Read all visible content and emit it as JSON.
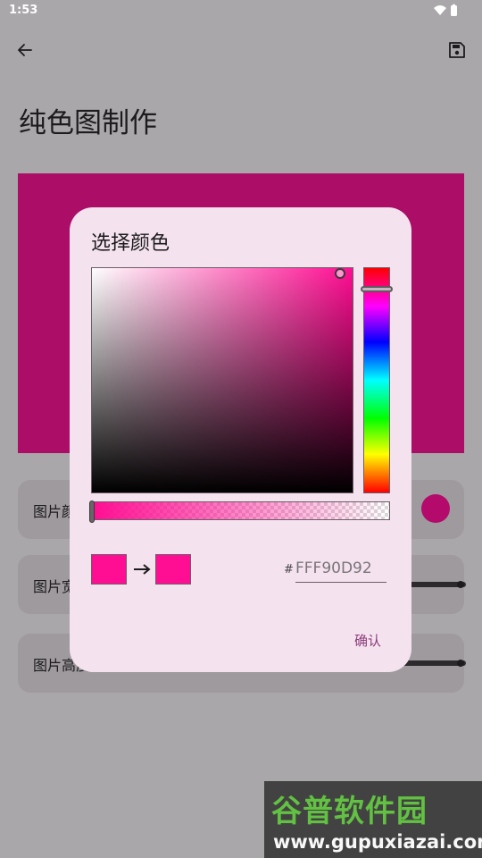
{
  "status_bar": {
    "time": "1:53",
    "icons": [
      "wifi-icon",
      "battery-icon"
    ]
  },
  "app_bar": {
    "back_icon": "back-arrow-icon",
    "save_icon": "save-icon",
    "title": "纯色图制作"
  },
  "preview": {
    "color": "#ab0d67"
  },
  "settings": {
    "rows": [
      {
        "label": "图片颜",
        "control": "color-dot"
      },
      {
        "label": "图片宽",
        "control": "slider"
      },
      {
        "label": "图片高度",
        "control": "slider"
      }
    ]
  },
  "dialog": {
    "title": "选择颜色",
    "selected_color": "#ff0d92",
    "hex_prefix": "#",
    "hex_value": "FFF90D92",
    "confirm_label": "确认"
  },
  "watermark": {
    "title": "谷普软件园",
    "url": "www.gupuxiazai.com"
  },
  "colors": {
    "background_dim": "#a9a7a9",
    "dialog_bg": "#f4e3ef",
    "accent": "#8a3b79"
  }
}
